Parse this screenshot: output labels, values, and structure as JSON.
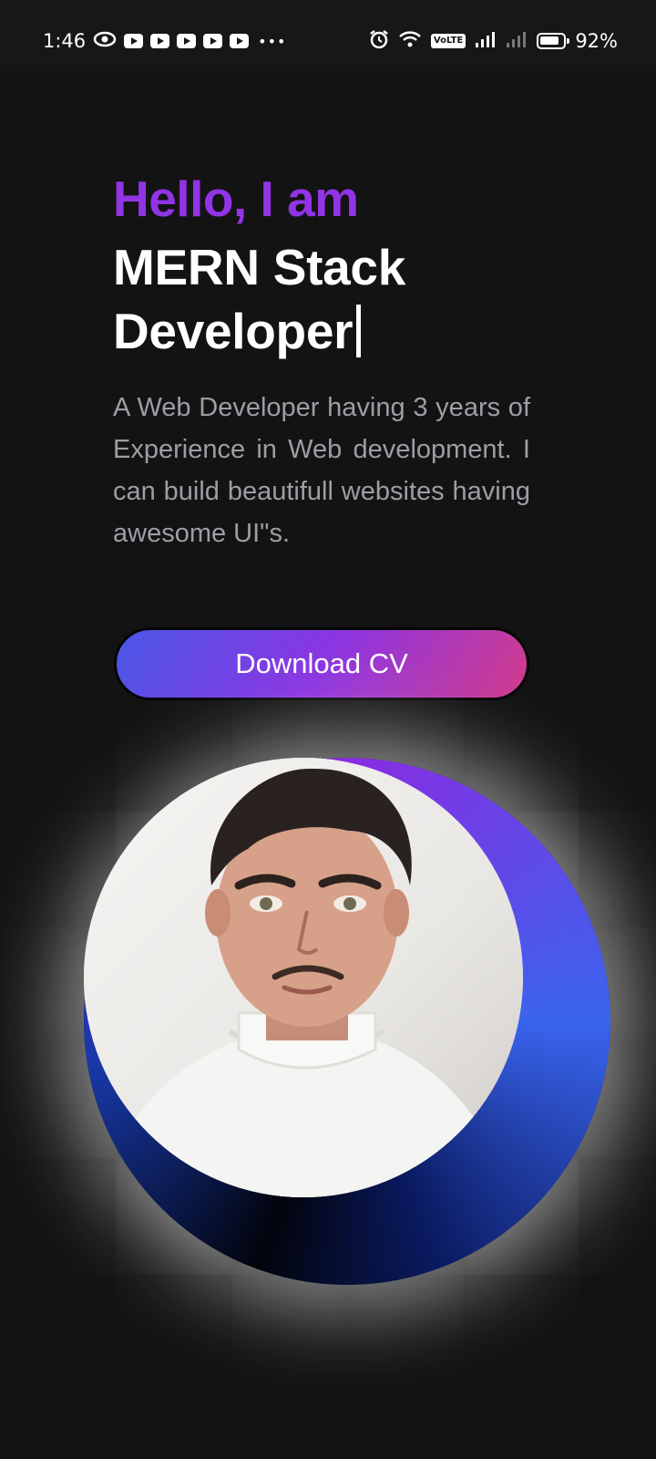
{
  "status_bar": {
    "time": "1:46",
    "battery_percent": "92%",
    "volte_label": "VoLTE",
    "notification_icons": [
      "eye-icon",
      "youtube-icon",
      "youtube-icon",
      "youtube-icon",
      "youtube-icon",
      "youtube-icon",
      "more-dots-icon"
    ],
    "system_icons": [
      "alarm-icon",
      "wifi-icon",
      "volte-icon",
      "signal-icon",
      "signal-icon",
      "battery-icon"
    ]
  },
  "hero": {
    "greeting": "Hello, I am",
    "role_line1": "MERN Stack",
    "role_line2": "Developer",
    "bio": "A Web Developer having 3 years of Experience in Web development. I can build beautifull websites having awesome UI\"s.",
    "cta_label": "Download CV"
  },
  "colors": {
    "background": "#131314",
    "accent_purple": "#9134e6",
    "button_gradient": [
      "#4957e6",
      "#8b35e2",
      "#d23c8c"
    ],
    "ring_blue": "#3a64ee"
  }
}
